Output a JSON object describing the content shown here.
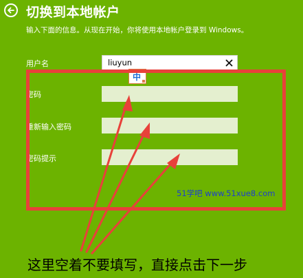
{
  "header": {
    "title": "切换到本地帐户",
    "subtitle": "输入下面的信息。从现在开始，你将使用本地帐户登录到 Windows。"
  },
  "form": {
    "username": {
      "label": "用户名",
      "value": "liuyun"
    },
    "password": {
      "label": "密码",
      "value": ""
    },
    "confirm_password": {
      "label": "重新输入密码",
      "value": ""
    },
    "password_hint": {
      "label": "密码提示",
      "value": ""
    }
  },
  "ime": {
    "mode": "中"
  },
  "annotation": {
    "watermark": "51学吧 www.51xue8.com",
    "caption": "这里空着不要填写，直接点击下一步",
    "box_color": "#e8413a",
    "arrow_color": "#e8413a"
  },
  "colors": {
    "background": "#6cb300",
    "empty_field": "#e4efcf"
  },
  "icons": {
    "back": "back-arrow-icon",
    "clear": "close-icon"
  }
}
